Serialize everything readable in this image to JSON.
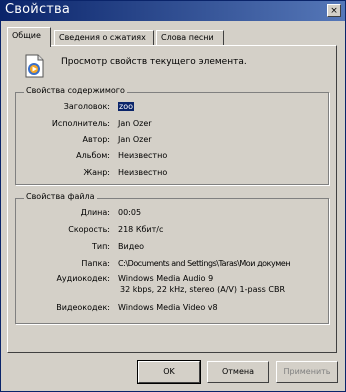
{
  "window": {
    "title": "Свойства",
    "close_glyph": "×"
  },
  "tabs": [
    {
      "label": "Общие"
    },
    {
      "label": "Сведения о сжатиях"
    },
    {
      "label": "Слова песни"
    }
  ],
  "header": {
    "description": "Просмотр свойств текущего элемента."
  },
  "content_group": {
    "title": "Свойства содержимого",
    "rows": [
      {
        "label": "Заголовок:",
        "value": "zoo"
      },
      {
        "label": "Исполнитель:",
        "value": "Jan Ozer"
      },
      {
        "label": "Автор:",
        "value": "Jan Ozer"
      },
      {
        "label": "Альбом:",
        "value": "Неизвестно"
      },
      {
        "label": "Жанр:",
        "value": "Неизвестно"
      }
    ]
  },
  "file_group": {
    "title": "Свойства файла",
    "rows": [
      {
        "label": "Длина:",
        "value": "00:05"
      },
      {
        "label": "Скорость:",
        "value": "218 Кбит/с"
      },
      {
        "label": "Тип:",
        "value": "Видео"
      },
      {
        "label": "Папка:",
        "value": "C:\\Documents and Settings\\Taras\\Мои докумен"
      },
      {
        "label": "Аудиокодек:",
        "value": "Windows Media Audio 9",
        "value2": "32 kbps, 22 kHz, stereo (A/V) 1-pass CBR"
      },
      {
        "label": "Видеокодек:",
        "value": "Windows Media Video v8"
      }
    ]
  },
  "buttons": {
    "ok": "OK",
    "cancel": "Отмена",
    "apply": "Применить"
  }
}
